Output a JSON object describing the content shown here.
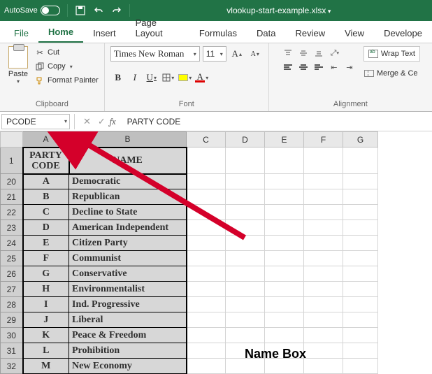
{
  "titlebar": {
    "autosave": "AutoSave",
    "filename": "vlookup-start-example.xlsx"
  },
  "tabs": {
    "file": "File",
    "home": "Home",
    "insert": "Insert",
    "page_layout": "Page Layout",
    "formulas": "Formulas",
    "data": "Data",
    "review": "Review",
    "view": "View",
    "developer": "Develope"
  },
  "ribbon": {
    "clipboard": {
      "title": "Clipboard",
      "paste": "Paste",
      "cut": "Cut",
      "copy": "Copy",
      "format_painter": "Format Painter"
    },
    "font": {
      "title": "Font",
      "name": "Times New Roman",
      "size": "11",
      "bold": "B",
      "italic": "I",
      "underline": "U",
      "lettera": "A"
    },
    "alignment": {
      "title": "Alignment",
      "wrap": "Wrap Text",
      "merge": "Merge & Ce"
    }
  },
  "formula_bar": {
    "namebox": "PCODE",
    "cancel": "✕",
    "enter": "✓",
    "fx": "fx",
    "value": "PARTY CODE"
  },
  "columns": [
    "A",
    "B",
    "C",
    "D",
    "E",
    "F",
    "G"
  ],
  "header_row_num": "1",
  "headers": {
    "a": "PARTY CODE",
    "b": "NAME"
  },
  "rows": [
    {
      "n": "20",
      "code": "A",
      "name": "Democratic"
    },
    {
      "n": "21",
      "code": "B",
      "name": "Republican"
    },
    {
      "n": "22",
      "code": "C",
      "name": "Decline to State"
    },
    {
      "n": "23",
      "code": "D",
      "name": "American Independent"
    },
    {
      "n": "24",
      "code": "E",
      "name": "Citizen Party"
    },
    {
      "n": "25",
      "code": "F",
      "name": "Communist"
    },
    {
      "n": "26",
      "code": "G",
      "name": "Conservative"
    },
    {
      "n": "27",
      "code": "H",
      "name": "Environmentalist"
    },
    {
      "n": "28",
      "code": "I",
      "name": "Ind. Progressive"
    },
    {
      "n": "29",
      "code": "J",
      "name": "Liberal"
    },
    {
      "n": "30",
      "code": "K",
      "name": "Peace & Freedom"
    },
    {
      "n": "31",
      "code": "L",
      "name": "Prohibition"
    },
    {
      "n": "32",
      "code": "M",
      "name": "New Economy"
    }
  ],
  "annotation": {
    "label": "Name Box"
  }
}
